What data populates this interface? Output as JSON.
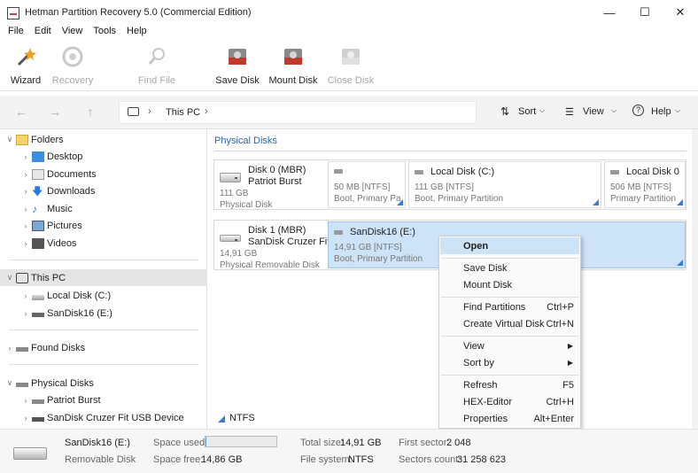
{
  "window": {
    "title": "Hetman Partition Recovery 5.0 (Commercial Edition)"
  },
  "menu": [
    "File",
    "Edit",
    "View",
    "Tools",
    "Help"
  ],
  "toolbar": {
    "wizard": "Wizard",
    "recovery": "Recovery",
    "find_file": "Find File",
    "save_disk": "Save Disk",
    "mount_disk": "Mount Disk",
    "close_disk": "Close Disk"
  },
  "nav": {
    "breadcrumb": "This PC",
    "sort": "Sort",
    "view": "View",
    "help": "Help"
  },
  "sidebar": {
    "folders": "Folders",
    "folder_items": [
      "Desktop",
      "Documents",
      "Downloads",
      "Music",
      "Pictures",
      "Videos"
    ],
    "this_pc": "This PC",
    "pc_items": [
      "Local Disk (C:)",
      "SanDisk16 (E:)"
    ],
    "found_disks": "Found Disks",
    "physical_disks": "Physical Disks",
    "physical_items": [
      "Patriot Burst",
      "SanDisk Cruzer Fit USB Device"
    ]
  },
  "main": {
    "section_title": "Physical Disks",
    "disk0": {
      "name": "Disk 0 (MBR)",
      "model": "Patriot Burst",
      "size": "111 GB",
      "type": "Physical Disk",
      "partitions": [
        {
          "name": "",
          "size": "50 MB [NTFS]",
          "flags": "Boot, Primary Pa"
        },
        {
          "name": "Local Disk (C:)",
          "size": "111 GB [NTFS]",
          "flags": "Boot, Primary Partition"
        },
        {
          "name": "Local Disk 0",
          "size": "506 MB [NTFS]",
          "flags": "Primary Partition"
        }
      ]
    },
    "disk1": {
      "name": "Disk 1 (MBR)",
      "model": "SanDisk Cruzer Fit U",
      "size": "14,91 GB",
      "type": "Physical Removable Disk",
      "partitions": [
        {
          "name": "SanDisk16 (E:)",
          "size": "14,91 GB [NTFS]",
          "flags": "Boot, Primary Partition"
        }
      ]
    },
    "fs_label": "NTFS"
  },
  "context_menu": {
    "open": "Open",
    "save_disk": "Save Disk",
    "mount_disk": "Mount Disk",
    "find_partitions": "Find Partitions",
    "find_partitions_key": "Ctrl+P",
    "create_virtual_disk": "Create Virtual Disk",
    "create_virtual_disk_key": "Ctrl+N",
    "view": "View",
    "sort_by": "Sort by",
    "refresh": "Refresh",
    "refresh_key": "F5",
    "hex_editor": "HEX-Editor",
    "hex_editor_key": "Ctrl+H",
    "properties": "Properties",
    "properties_key": "Alt+Enter"
  },
  "status": {
    "name": "SanDisk16 (E:)",
    "type": "Removable Disk",
    "space_used_label": "Space used:",
    "space_used_fraction": 0.005,
    "space_free_label": "Space free:",
    "space_free": "14,86 GB",
    "total_size_label": "Total size:",
    "total_size": "14,91 GB",
    "file_system_label": "File system:",
    "file_system": "NTFS",
    "first_sector_label": "First sector:",
    "first_sector": "2 048",
    "sectors_count_label": "Sectors count:",
    "sectors_count": "31 258 623"
  },
  "colors": {
    "accent": "#2664b8",
    "selection": "#cde3f7",
    "corner": "#3a7bd5"
  }
}
